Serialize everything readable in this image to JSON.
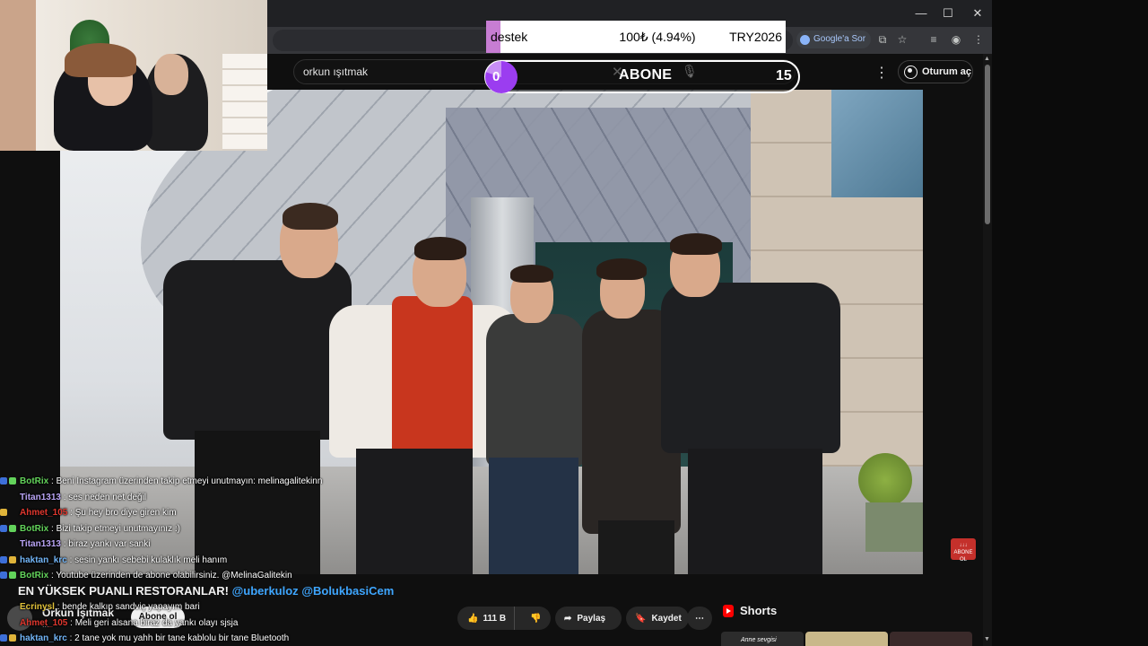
{
  "donation": {
    "title": "destek",
    "amount": "100₺ (4.94%)",
    "code": "TRY2026",
    "progress": 0.0494,
    "fill_color": "#c77dd3"
  },
  "browser": {
    "google_sor_label": "Google'a Sor",
    "minimize": "—",
    "maximize": "☐",
    "close": "✕"
  },
  "youtube": {
    "search_value": "orkun ışıtmak",
    "signin_label": "Oturum aç"
  },
  "sub_goal": {
    "current": "0",
    "label": "ABONE",
    "target": "15",
    "accent": "#9b3df0"
  },
  "video": {
    "title_prefix": "EN YÜKSEK PUANLI RESTORANLAR!",
    "title_mention_1": "@uberkuloz",
    "title_mention_2": "@BolukbasiCem",
    "channel_name": "Orkun Işıtmak",
    "channel_subs": "...",
    "subscribe_label": "Abone ol",
    "likes": "111 B",
    "share_label": "Paylaş",
    "save_label": "Kaydet",
    "overlay_badge": "ABONE OL"
  },
  "shorts": {
    "header": "Shorts",
    "first_label": "Anne sevgisi"
  },
  "chat": [
    {
      "user": "BotRix",
      "color": "#63d35b",
      "badges": [
        "#3d6fd8",
        "#63d35b"
      ],
      "message": ": Beni Instagram üzerinden takip etmeyi unutmayın: melinagalitekinn"
    },
    {
      "user": "Titan1313",
      "color": "#b9a4f5",
      "badges": [],
      "message": ": ses neden net değil"
    },
    {
      "user": "Ahmet_105",
      "color": "#e0372e",
      "badges": [
        "#e0b43a"
      ],
      "message": ": Şu hey bro diye giren kim"
    },
    {
      "user": "BotRix",
      "color": "#63d35b",
      "badges": [
        "#3d6fd8",
        "#63d35b"
      ],
      "message": ": Bizi takip etmeyi unutmayınız :)"
    },
    {
      "user": "Titan1313",
      "color": "#b9a4f5",
      "badges": [],
      "message": ": biraz yankı var sanki"
    },
    {
      "user": "haktan_krc",
      "color": "#72b5f7",
      "badges": [
        "#3d6fd8",
        "#e0b43a"
      ],
      "message": ": sesin yankı sebebi kulaklık meli hanım"
    },
    {
      "user": "BotRix",
      "color": "#63d35b",
      "badges": [
        "#3d6fd8",
        "#63d35b"
      ],
      "message": ": Youtube üzerinden de abone olabilirsiniz. @MelinaGalitekin"
    },
    {
      "user": "",
      "color": "#ffffff",
      "badges": [],
      "message": ""
    },
    {
      "user": "Ecrinysl",
      "color": "#e2c33a",
      "badges": [],
      "message": ": bende kalkıp sandviç yapayım bari"
    },
    {
      "user": "Ahmet_105",
      "color": "#e0372e",
      "badges": [],
      "message": ": Meli geri alsana biraz da yankı olayı sjsja"
    },
    {
      "user": "haktan_krc",
      "color": "#72b5f7",
      "badges": [
        "#3d6fd8",
        "#e0b43a"
      ],
      "message": ": 2 tane yok mu yahh bir tane kablolu bir tane Bluetooth"
    }
  ]
}
